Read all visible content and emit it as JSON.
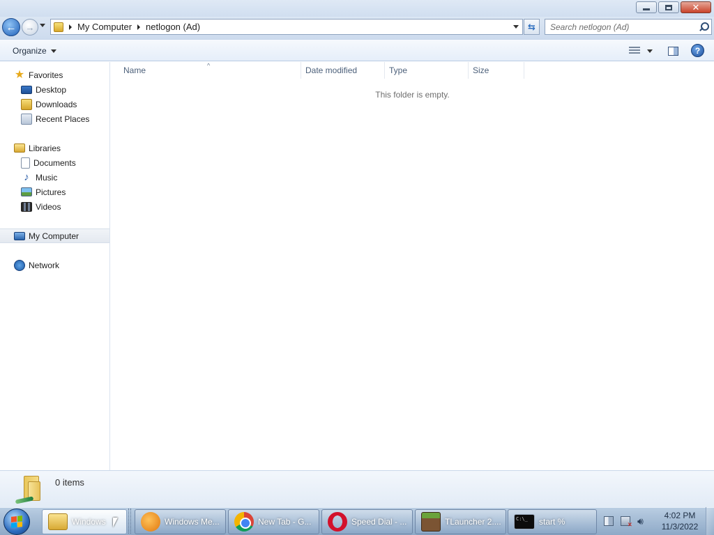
{
  "titlebar": {
    "buttons": {
      "minimize": "minimize",
      "maximize": "restore",
      "close": "close"
    }
  },
  "address": {
    "crumbs": [
      "My Computer",
      "netlogon (Ad)"
    ]
  },
  "search": {
    "placeholder": "Search netlogon (Ad)"
  },
  "toolbar": {
    "organize_label": "Organize",
    "help_label": "?"
  },
  "nav": {
    "favorites": {
      "label": "Favorites",
      "items": [
        {
          "label": "Desktop",
          "icon": "desktop-icon"
        },
        {
          "label": "Downloads",
          "icon": "downloads-icon"
        },
        {
          "label": "Recent Places",
          "icon": "recent-places-icon"
        }
      ]
    },
    "libraries": {
      "label": "Libraries",
      "items": [
        {
          "label": "Documents",
          "icon": "documents-icon"
        },
        {
          "label": "Music",
          "icon": "music-icon"
        },
        {
          "label": "Pictures",
          "icon": "pictures-icon"
        },
        {
          "label": "Videos",
          "icon": "videos-icon"
        }
      ]
    },
    "computer": {
      "label": "My Computer",
      "selected": true
    },
    "network": {
      "label": "Network"
    }
  },
  "filelist": {
    "columns": [
      "Name",
      "Date modified",
      "Type",
      "Size"
    ],
    "empty_message": "This folder is empty."
  },
  "details": {
    "item_count": "0 items"
  },
  "taskbar": {
    "tasks": [
      {
        "label": "Windows",
        "icon": "explorer-icon",
        "active": true
      },
      {
        "label": "Windows Me...",
        "icon": "media-player-icon"
      },
      {
        "label": "New Tab - G...",
        "icon": "chrome-icon"
      },
      {
        "label": "Speed Dial - ...",
        "icon": "opera-icon"
      },
      {
        "label": "TLauncher 2....",
        "icon": "tlauncher-icon"
      },
      {
        "label": "start  %",
        "icon": "cmd-icon"
      }
    ],
    "cmd_icon_text": "C:\\_",
    "clock": {
      "time": "4:02 PM",
      "date": "11/3/2022"
    }
  },
  "colors": {
    "accent": "#2c6cbf",
    "empty_text": "#6d6d6d",
    "header_text": "#4c607a"
  }
}
